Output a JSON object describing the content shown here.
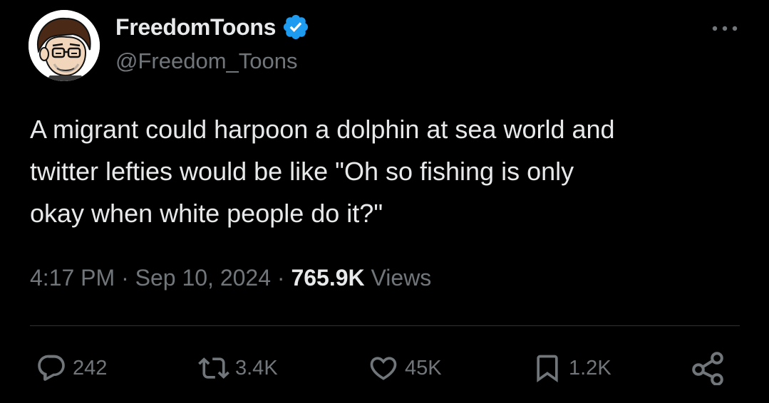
{
  "author": {
    "display_name": "FreedomToons",
    "handle": "@Freedom_Toons",
    "verified": true,
    "avatar_icon": "cartoon-man-avatar"
  },
  "tweet": {
    "text": "A migrant could harpoon a dolphin at sea world and\ntwitter lefties would be like \"Oh so fishing is only\nokay when white people do it?\"",
    "time": "4:17 PM",
    "separator": "·",
    "date": "Sep 10, 2024",
    "views_count": "765.9K",
    "views_label": "Views"
  },
  "actions": {
    "replies": "242",
    "retweets": "3.4K",
    "likes": "45K",
    "bookmarks": "1.2K"
  },
  "icons": {
    "more": "more-horizontal-icon",
    "reply": "reply-bubble-icon",
    "retweet": "retweet-arrows-icon",
    "like": "heart-icon",
    "bookmark": "bookmark-icon",
    "share": "share-nodes-icon",
    "verified": "verified-badge-icon"
  },
  "colors": {
    "background": "#000000",
    "text_primary": "#e7e9ea",
    "text_secondary": "#71767b",
    "verified_blue": "#1d9bf0",
    "divider": "#2f3336"
  }
}
